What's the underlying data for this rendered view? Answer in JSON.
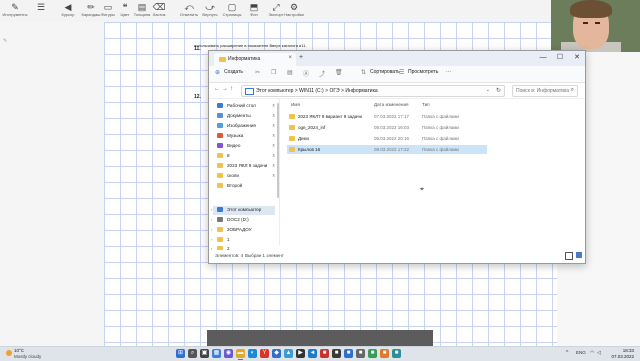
{
  "whiteboard": {
    "tools": [
      {
        "glyph": "✎",
        "label": "Инструменты"
      },
      {
        "glyph": "☰",
        "label": ""
      },
      {
        "glyph": "◀",
        "label": "Курсор"
      },
      {
        "glyph": "✏",
        "label": "Карандаш"
      },
      {
        "glyph": "▭",
        "label": "Фигуры"
      },
      {
        "glyph": "❝",
        "label": "Цвет"
      },
      {
        "glyph": "▤",
        "label": "Толщина"
      },
      {
        "glyph": "⌫",
        "label": "Ластик"
      },
      {
        "glyph": "⤺",
        "label": "Отменить"
      },
      {
        "glyph": "⤻",
        "label": "Вернуть"
      },
      {
        "glyph": "▢",
        "label": "Страницы"
      },
      {
        "glyph": "⬒",
        "label": "Фон"
      },
      {
        "glyph": "⤢",
        "label": "Экспорт"
      },
      {
        "glyph": "⚙",
        "label": "Настройки"
      }
    ],
    "page_numbers": [
      "11.",
      "12."
    ],
    "scan_heading": "использовать расширение в показателе Вверх каталога и11."
  },
  "explorer": {
    "tab_title": "Информатика",
    "new_tab": "+",
    "window_controls": {
      "minimize": "—",
      "maximize": "☐",
      "close": "✕"
    },
    "cmd": {
      "create": "Создать",
      "sort": "Сортировать",
      "view": "Просмотреть",
      "more": "···"
    },
    "breadcrumbs": [
      "Этот компьютер",
      "WIN11 (C:)",
      "ОГЭ",
      "Информатика"
    ],
    "search_placeholder": "Поиск в: Информатика",
    "nav_items": [
      {
        "label": "Рабочий стол",
        "icon_color": "#3a7bd5",
        "pinned": true
      },
      {
        "label": "Документы",
        "icon_color": "#5b8fd8",
        "pinned": true
      },
      {
        "label": "Изображения",
        "icon_color": "#4fa0d8",
        "pinned": true
      },
      {
        "label": "Музыка",
        "icon_color": "#e0583a",
        "pinned": true
      },
      {
        "label": "Видео",
        "icon_color": "#8a4fd8",
        "pinned": true
      },
      {
        "label": "8",
        "icon_color": "#f2c34a",
        "pinned": true
      },
      {
        "label": "2023 ЯКЛ 9 задачи",
        "icon_color": "#f2c34a",
        "pinned": true
      },
      {
        "label": "cкопи",
        "icon_color": "#f2c34a",
        "pinned": true
      },
      {
        "label": "Второй",
        "icon_color": "#f2c34a",
        "pinned": false
      },
      {
        "label": "Этот компьютер",
        "icon_color": "#3a7bd5",
        "pinned": false,
        "selected": true
      },
      {
        "label": "DOC2 (D:)",
        "icon_color": "#777777",
        "pinned": false
      },
      {
        "label": "2ОБРАДОУ",
        "icon_color": "#f2c34a",
        "pinned": false
      },
      {
        "label": "1",
        "icon_color": "#f2c34a",
        "pinned": false
      },
      {
        "label": "2",
        "icon_color": "#f2c34a",
        "pinned": false
      }
    ],
    "columns": {
      "name": "Имя",
      "date": "Дата изменения",
      "type": "Тип"
    },
    "files": [
      {
        "name": "2023 ЯКЛ7 9 вариант 9 задачи",
        "date": "07.03.2022 17:17",
        "type": "Папка с файлами"
      },
      {
        "name": "oge_2024_inf",
        "date": "05.03.2022 16:03",
        "type": "Папка с файлами"
      },
      {
        "name": "Демо",
        "date": "05.03.2022 20:16",
        "type": "Папка с файлами"
      },
      {
        "name": "Крылов 16",
        "date": "08.03.2022 17:22",
        "type": "Папка с файлами",
        "selected": true
      }
    ],
    "status": {
      "count": "Элементов: 4",
      "selected": "Выбран 1 элемент"
    }
  },
  "taskbar": {
    "weather_temp": "10°C",
    "weather_cond": "Mostly cloudy",
    "apps": [
      {
        "name": "windows-start",
        "glyph": "⊞",
        "color": "#2f6fd0"
      },
      {
        "name": "search",
        "glyph": "⌕",
        "color": "#555555"
      },
      {
        "name": "task-view",
        "glyph": "▣",
        "color": "#444444"
      },
      {
        "name": "widgets",
        "glyph": "▦",
        "color": "#3f7fd8"
      },
      {
        "name": "chat",
        "glyph": "◉",
        "color": "#6a5acd"
      },
      {
        "name": "file-explorer",
        "glyph": "▬",
        "color": "#e3a82a"
      },
      {
        "name": "edge",
        "glyph": "◐",
        "color": "#1d8ad6"
      },
      {
        "name": "yandex",
        "glyph": "Y",
        "color": "#d8342a"
      },
      {
        "name": "store",
        "glyph": "◆",
        "color": "#2f6fd0"
      },
      {
        "name": "photos",
        "glyph": "▲",
        "color": "#3a9bd5"
      },
      {
        "name": "terminal",
        "glyph": "▶",
        "color": "#333333"
      },
      {
        "name": "vscode",
        "glyph": "◄",
        "color": "#1f7ac8"
      },
      {
        "name": "app-red",
        "glyph": "■",
        "color": "#c8342a"
      },
      {
        "name": "app-dark",
        "glyph": "■",
        "color": "#3a3a3a"
      },
      {
        "name": "app-blue",
        "glyph": "■",
        "color": "#2f6fd0"
      },
      {
        "name": "app-gray",
        "glyph": "■",
        "color": "#666666"
      },
      {
        "name": "app-green",
        "glyph": "■",
        "color": "#3a9b5a"
      },
      {
        "name": "app-orange",
        "glyph": "■",
        "color": "#e07a2a"
      },
      {
        "name": "app-teal",
        "glyph": "■",
        "color": "#2a8f9b"
      }
    ],
    "tray_chevron": "^",
    "tray_lang": "ENG",
    "time": "18:33",
    "date": "07.03.2022"
  }
}
